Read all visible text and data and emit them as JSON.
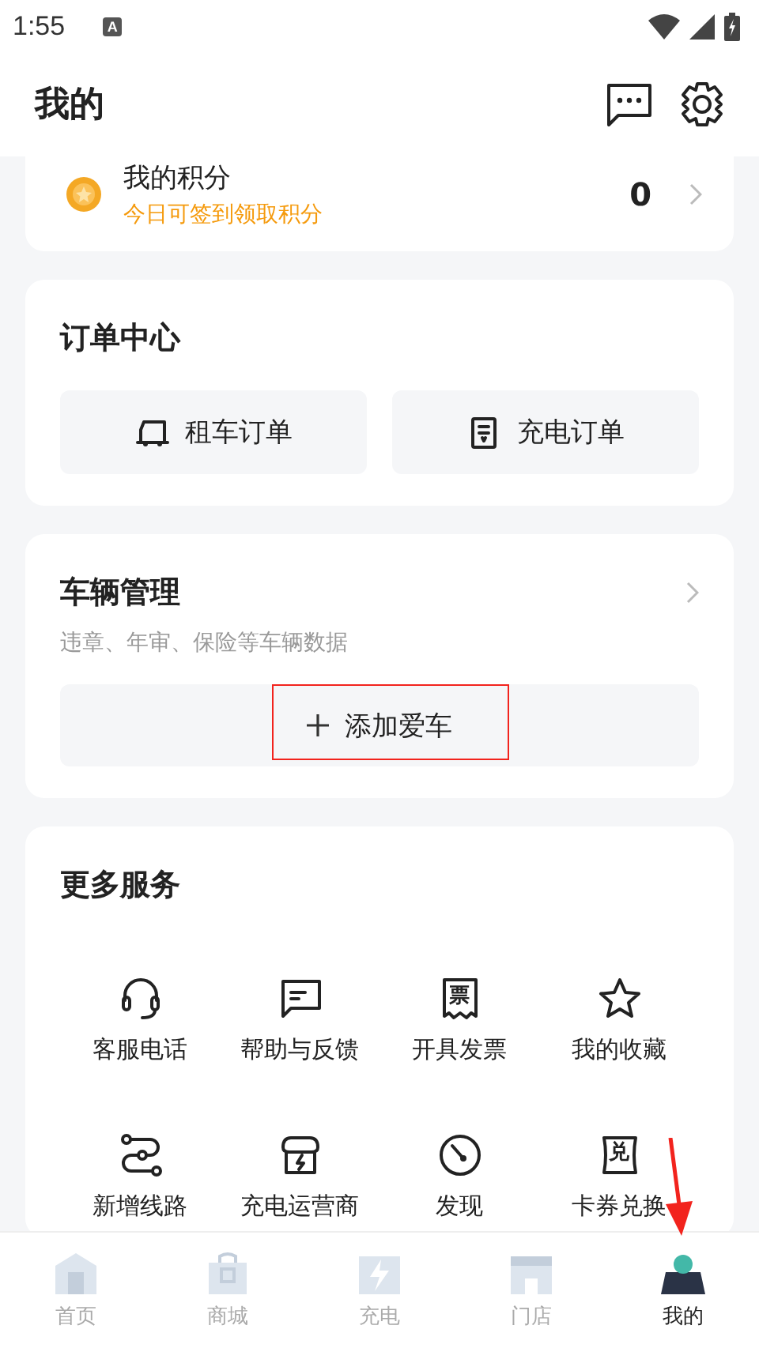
{
  "status_bar": {
    "time": "1:55",
    "notification": "A"
  },
  "header": {
    "title": "我的"
  },
  "points": {
    "title": "我的积分",
    "subtitle": "今日可签到领取积分",
    "value": "0"
  },
  "orders": {
    "title": "订单中心",
    "buttons": [
      {
        "kind": "truck",
        "label": "租车订单"
      },
      {
        "kind": "receipt",
        "label": "充电订单"
      }
    ]
  },
  "vehicle": {
    "title": "车辆管理",
    "subtitle": "违章、年审、保险等车辆数据",
    "add_button": "添加爱车"
  },
  "services": {
    "title": "更多服务",
    "items": [
      {
        "kind": "headset",
        "label": "客服电话"
      },
      {
        "kind": "chat",
        "label": "帮助与反馈"
      },
      {
        "kind": "ticket",
        "icon_text": "票",
        "label": "开具发票"
      },
      {
        "kind": "star",
        "label": "我的收藏"
      },
      {
        "kind": "route",
        "label": "新增线路"
      },
      {
        "kind": "store",
        "label": "充电运营商"
      },
      {
        "kind": "gauge",
        "label": "发现"
      },
      {
        "kind": "coupon",
        "icon_text": "兑",
        "label": "卡券兑换"
      }
    ]
  },
  "tab_bar": [
    {
      "kind": "home",
      "label": "首页",
      "selected": false
    },
    {
      "kind": "bag",
      "label": "商城",
      "selected": false
    },
    {
      "kind": "bolt",
      "label": "充电",
      "selected": false
    },
    {
      "kind": "shop",
      "label": "门店",
      "selected": false
    },
    {
      "kind": "person",
      "label": "我的",
      "selected": true
    }
  ]
}
